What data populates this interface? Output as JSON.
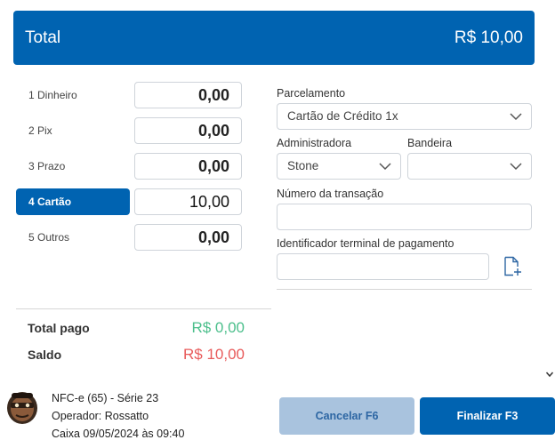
{
  "header": {
    "title": "Total",
    "total_value": "R$ 10,00"
  },
  "payments": [
    {
      "label": "1 Dinheiro",
      "value": "0,00",
      "active": false
    },
    {
      "label": "2 Pix",
      "value": "0,00",
      "active": false
    },
    {
      "label": "3 Prazo",
      "value": "0,00",
      "active": false
    },
    {
      "label": "4 Cartão",
      "value": "10,00",
      "active": true
    },
    {
      "label": "5 Outros",
      "value": "0,00",
      "active": false
    }
  ],
  "card_form": {
    "parcelamento_label": "Parcelamento",
    "parcelamento_value": "Cartão de Crédito 1x",
    "administradora_label": "Administradora",
    "administradora_value": "Stone",
    "bandeira_label": "Bandeira",
    "bandeira_value": "",
    "transacao_label": "Número da transação",
    "transacao_value": "",
    "terminal_label": "Identificador terminal de pagamento",
    "terminal_value": ""
  },
  "summary": {
    "total_pago_label": "Total pago",
    "total_pago_value": "R$ 0,00",
    "saldo_label": "Saldo",
    "saldo_value": "R$ 10,00"
  },
  "footer": {
    "nfce": "NFC-e (65) - Série 23",
    "operador": "Operador: Rossatto",
    "caixa": "Caixa 09/05/2024 às 09:40"
  },
  "buttons": {
    "cancel": "Cancelar F6",
    "finish": "Finalizar F3"
  },
  "colors": {
    "primary": "#0063b1",
    "cancel_bg": "#a9c3de",
    "paid_green": "#4cbf8c",
    "balance_red": "#e85a5a"
  },
  "icons": [
    "chevron-down-icon",
    "file-add-icon",
    "scroll-down-icon",
    "operator-avatar"
  ]
}
